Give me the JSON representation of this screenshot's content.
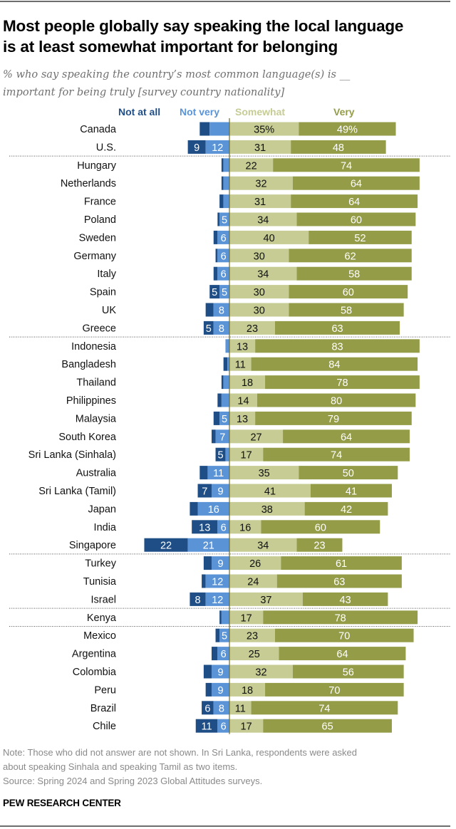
{
  "header": {
    "title_line1": "Most people globally say speaking the local language",
    "title_line2": "is at least somewhat important for belonging",
    "subtitle_line1": "% who say speaking the country’s most common language(s) is __",
    "subtitle_line2": "important for being truly [survey country nationality]"
  },
  "colors": {
    "not_at_all": "#1f4e87",
    "not_very": "#5b94d6",
    "somewhat": "#c6cc93",
    "very": "#949c48",
    "axis": "#6b6b2a"
  },
  "chart_data": {
    "type": "bar",
    "orientation": "horizontal",
    "stacked": "diverging",
    "title": "Most people globally say speaking the local language is at least somewhat important for belonging",
    "xlabel": "",
    "ylabel": "",
    "unit": "%",
    "legend": [
      "Not at all",
      "Not very",
      "Somewhat",
      "Very"
    ],
    "legend_placement": "top",
    "group_breaks_after": [
      "U.S.",
      "Greece",
      "Singapore",
      "Israel",
      "Kenya"
    ],
    "rows": [
      {
        "country": "Canada",
        "not_at_all": 5,
        "not_very": 10,
        "somewhat": 35,
        "very": 49,
        "labels": {
          "not_at_all": "",
          "not_very": "",
          "somewhat": "35%",
          "very": "49%"
        }
      },
      {
        "country": "U.S.",
        "not_at_all": 9,
        "not_very": 12,
        "somewhat": 31,
        "very": 48,
        "labels": {
          "not_at_all": "9",
          "not_very": "12",
          "somewhat": "31",
          "very": "48"
        }
      },
      {
        "country": "Hungary",
        "not_at_all": 1,
        "not_very": 3,
        "somewhat": 22,
        "very": 74,
        "labels": {
          "not_at_all": "",
          "not_very": "",
          "somewhat": "22",
          "very": "74"
        }
      },
      {
        "country": "Netherlands",
        "not_at_all": 1,
        "not_very": 3,
        "somewhat": 32,
        "very": 64,
        "labels": {
          "not_at_all": "",
          "not_very": "",
          "somewhat": "32",
          "very": "64"
        }
      },
      {
        "country": "France",
        "not_at_all": 2,
        "not_very": 3,
        "somewhat": 31,
        "very": 64,
        "labels": {
          "not_at_all": "",
          "not_very": "",
          "somewhat": "31",
          "very": "64"
        }
      },
      {
        "country": "Poland",
        "not_at_all": 1,
        "not_very": 5,
        "somewhat": 34,
        "very": 60,
        "labels": {
          "not_at_all": "",
          "not_very": "5",
          "somewhat": "34",
          "very": "60"
        }
      },
      {
        "country": "Sweden",
        "not_at_all": 2,
        "not_very": 6,
        "somewhat": 40,
        "very": 52,
        "labels": {
          "not_at_all": "",
          "not_very": "6",
          "somewhat": "40",
          "very": "52"
        }
      },
      {
        "country": "Germany",
        "not_at_all": 1,
        "not_very": 6,
        "somewhat": 30,
        "very": 62,
        "labels": {
          "not_at_all": "",
          "not_very": "6",
          "somewhat": "30",
          "very": "62"
        }
      },
      {
        "country": "Italy",
        "not_at_all": 2,
        "not_very": 6,
        "somewhat": 34,
        "very": 58,
        "labels": {
          "not_at_all": "",
          "not_very": "6",
          "somewhat": "34",
          "very": "58"
        }
      },
      {
        "country": "Spain",
        "not_at_all": 5,
        "not_very": 5,
        "somewhat": 30,
        "very": 60,
        "labels": {
          "not_at_all": "5",
          "not_very": "5",
          "somewhat": "30",
          "very": "60"
        }
      },
      {
        "country": "UK",
        "not_at_all": 4,
        "not_very": 8,
        "somewhat": 30,
        "very": 58,
        "labels": {
          "not_at_all": "",
          "not_very": "8",
          "somewhat": "30",
          "very": "58"
        }
      },
      {
        "country": "Greece",
        "not_at_all": 5,
        "not_very": 8,
        "somewhat": 23,
        "very": 63,
        "labels": {
          "not_at_all": "5",
          "not_very": "8",
          "somewhat": "23",
          "very": "63"
        }
      },
      {
        "country": "Indonesia",
        "not_at_all": 0,
        "not_very": 2,
        "somewhat": 13,
        "very": 83,
        "labels": {
          "not_at_all": "",
          "not_very": "",
          "somewhat": "13",
          "very": "83"
        }
      },
      {
        "country": "Bangladesh",
        "not_at_all": 2,
        "not_very": 1,
        "somewhat": 11,
        "very": 84,
        "labels": {
          "not_at_all": "",
          "not_very": "",
          "somewhat": "11",
          "very": "84"
        }
      },
      {
        "country": "Thailand",
        "not_at_all": 1,
        "not_very": 3,
        "somewhat": 18,
        "very": 78,
        "labels": {
          "not_at_all": "",
          "not_very": "",
          "somewhat": "18",
          "very": "78"
        }
      },
      {
        "country": "Philippines",
        "not_at_all": 2,
        "not_very": 4,
        "somewhat": 14,
        "very": 80,
        "labels": {
          "not_at_all": "",
          "not_very": "",
          "somewhat": "14",
          "very": "80"
        }
      },
      {
        "country": "Malaysia",
        "not_at_all": 3,
        "not_very": 5,
        "somewhat": 13,
        "very": 79,
        "labels": {
          "not_at_all": "",
          "not_very": "5",
          "somewhat": "13",
          "very": "79"
        }
      },
      {
        "country": "South Korea",
        "not_at_all": 2,
        "not_very": 7,
        "somewhat": 27,
        "very": 64,
        "labels": {
          "not_at_all": "",
          "not_very": "7",
          "somewhat": "27",
          "very": "64"
        }
      },
      {
        "country": "Sri Lanka (Sinhala)",
        "not_at_all": 5,
        "not_very": 2,
        "somewhat": 17,
        "very": 74,
        "labels": {
          "not_at_all": "5",
          "not_very": "",
          "somewhat": "17",
          "very": "74"
        }
      },
      {
        "country": "Australia",
        "not_at_all": 4,
        "not_very": 11,
        "somewhat": 35,
        "very": 50,
        "labels": {
          "not_at_all": "",
          "not_very": "11",
          "somewhat": "35",
          "very": "50"
        }
      },
      {
        "country": "Sri Lanka (Tamil)",
        "not_at_all": 7,
        "not_very": 9,
        "somewhat": 41,
        "very": 41,
        "labels": {
          "not_at_all": "7",
          "not_very": "9",
          "somewhat": "41",
          "very": "41"
        }
      },
      {
        "country": "Japan",
        "not_at_all": 4,
        "not_very": 16,
        "somewhat": 38,
        "very": 42,
        "labels": {
          "not_at_all": "",
          "not_very": "16",
          "somewhat": "38",
          "very": "42"
        }
      },
      {
        "country": "India",
        "not_at_all": 13,
        "not_very": 6,
        "somewhat": 16,
        "very": 60,
        "labels": {
          "not_at_all": "13",
          "not_very": "6",
          "somewhat": "16",
          "very": "60"
        }
      },
      {
        "country": "Singapore",
        "not_at_all": 22,
        "not_very": 21,
        "somewhat": 34,
        "very": 23,
        "labels": {
          "not_at_all": "22",
          "not_very": "21",
          "somewhat": "34",
          "very": "23"
        }
      },
      {
        "country": "Turkey",
        "not_at_all": 4,
        "not_very": 9,
        "somewhat": 26,
        "very": 61,
        "labels": {
          "not_at_all": "",
          "not_very": "9",
          "somewhat": "26",
          "very": "61"
        }
      },
      {
        "country": "Tunisia",
        "not_at_all": 2,
        "not_very": 12,
        "somewhat": 24,
        "very": 63,
        "labels": {
          "not_at_all": "",
          "not_very": "12",
          "somewhat": "24",
          "very": "63"
        }
      },
      {
        "country": "Israel",
        "not_at_all": 8,
        "not_very": 12,
        "somewhat": 37,
        "very": 43,
        "labels": {
          "not_at_all": "8",
          "not_very": "12",
          "somewhat": "37",
          "very": "43"
        }
      },
      {
        "country": "Kenya",
        "not_at_all": 1,
        "not_very": 4,
        "somewhat": 17,
        "very": 78,
        "labels": {
          "not_at_all": "",
          "not_very": "",
          "somewhat": "17",
          "very": "78"
        }
      },
      {
        "country": "Mexico",
        "not_at_all": 2,
        "not_very": 5,
        "somewhat": 23,
        "very": 70,
        "labels": {
          "not_at_all": "",
          "not_very": "5",
          "somewhat": "23",
          "very": "70"
        }
      },
      {
        "country": "Argentina",
        "not_at_all": 3,
        "not_very": 6,
        "somewhat": 25,
        "very": 64,
        "labels": {
          "not_at_all": "",
          "not_very": "6",
          "somewhat": "25",
          "very": "64"
        }
      },
      {
        "country": "Colombia",
        "not_at_all": 4,
        "not_very": 9,
        "somewhat": 32,
        "very": 56,
        "labels": {
          "not_at_all": "",
          "not_very": "9",
          "somewhat": "32",
          "very": "56"
        }
      },
      {
        "country": "Peru",
        "not_at_all": 3,
        "not_very": 9,
        "somewhat": 18,
        "very": 70,
        "labels": {
          "not_at_all": "",
          "not_very": "9",
          "somewhat": "18",
          "very": "70"
        }
      },
      {
        "country": "Brazil",
        "not_at_all": 6,
        "not_very": 8,
        "somewhat": 11,
        "very": 74,
        "labels": {
          "not_at_all": "6",
          "not_very": "8",
          "somewhat": "11",
          "very": "74"
        }
      },
      {
        "country": "Chile",
        "not_at_all": 11,
        "not_very": 6,
        "somewhat": 17,
        "very": 65,
        "labels": {
          "not_at_all": "11",
          "not_very": "6",
          "somewhat": "17",
          "very": "65"
        }
      }
    ]
  },
  "footer": {
    "note_line1": "Note: Those who did not answer are not shown. In Sri Lanka, respondents were asked",
    "note_line2": "about speaking Sinhala and speaking Tamil as two items.",
    "source": "Source:  Spring 2024 and Spring 2023 Global Attitudes surveys.",
    "credit": "PEW RESEARCH CENTER"
  }
}
